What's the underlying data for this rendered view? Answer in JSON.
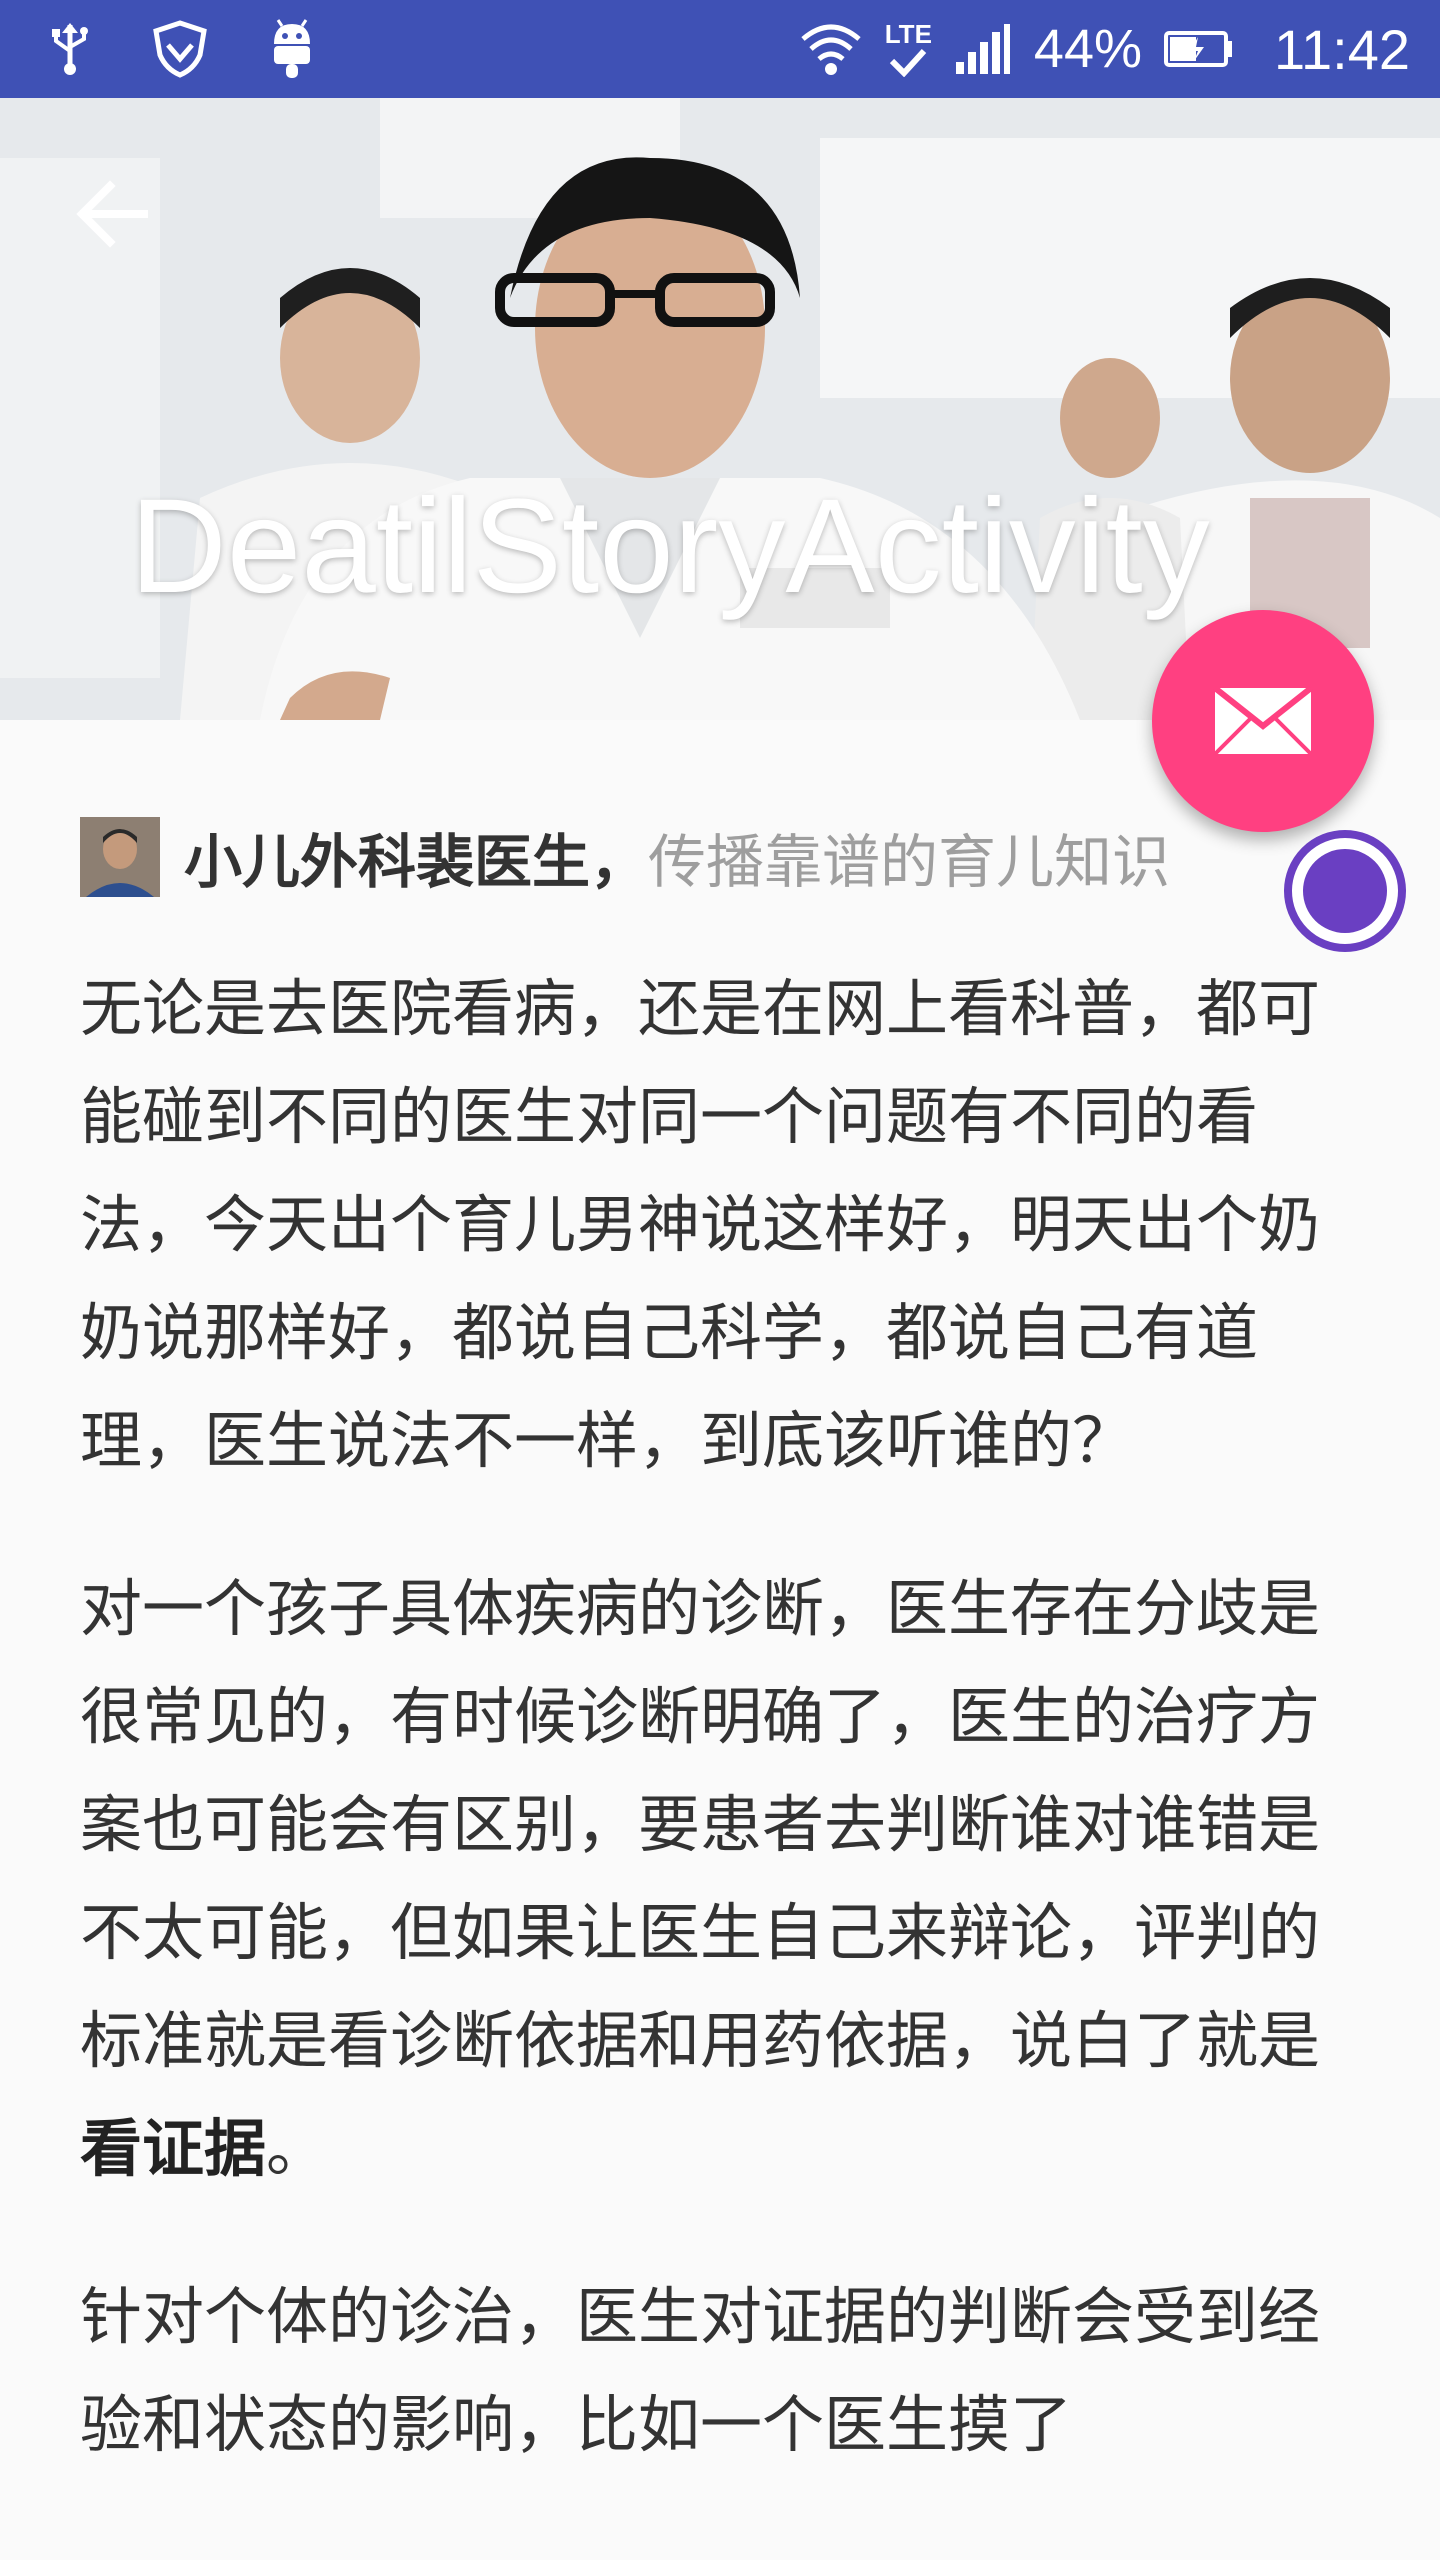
{
  "status_bar": {
    "battery": "44%",
    "time": "11:42",
    "network": "LTE"
  },
  "toolbar": {
    "title": "DeatilStoryActivity"
  },
  "author": {
    "name": "小儿外科裴医生",
    "separator": "，",
    "tagline": "传播靠谱的育儿知识"
  },
  "article": {
    "paragraph_1": "无论是去医院看病，还是在网上看科普，都可能碰到不同的医生对同一个问题有不同的看法，今天出个育儿男神说这样好，明天出个奶奶说那样好，都说自己科学，都说自己有道理，医生说法不一样，到底该听谁的？",
    "paragraph_2": "对一个孩子具体疾病的诊断，医生存在分歧是很常见的，有时候诊断明确了，医生的治疗方案也可能会有区别，要患者去判断谁对谁错是不太可能，但如果让医生自己来辩论，评判的标准就是看诊断依据和用药依据，说白了就是",
    "paragraph_2_bold": "看证据",
    "paragraph_2_end": "。",
    "paragraph_3": "针对个体的诊治，医生对证据的判断会受到经验和状态的影响，比如一个医生摸了"
  },
  "colors": {
    "status_bar": "#3f51b5",
    "fab": "#ff4081",
    "floating_dot": "#6a3fc2"
  },
  "icons": {
    "back": "arrow-left-icon",
    "fab": "mail-icon"
  }
}
